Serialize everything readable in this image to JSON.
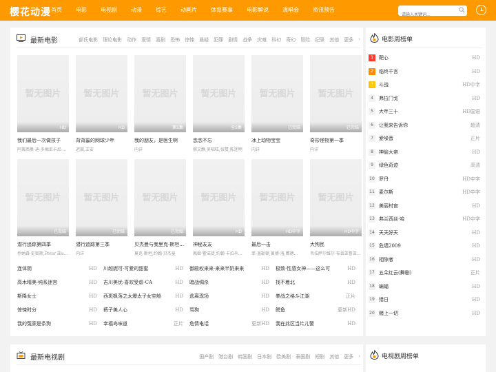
{
  "header": {
    "logo": "樱花动漫",
    "nav": [
      "首页",
      "电影",
      "电视剧",
      "动漫",
      "综艺",
      "动画片",
      "体育赛事",
      "电影解说",
      "演唱会",
      "资讯预告"
    ],
    "search_placeholder": "请输入关键词..."
  },
  "colors": {
    "brand": "#ff9900",
    "rank1": "#ff3b30",
    "rank2": "#ff8a00",
    "rank3": "#ffc400"
  },
  "movies_section": {
    "title": "最新电影",
    "categories": [
      "部氏电影",
      "理论电影",
      "动作",
      "爱情",
      "喜剧",
      "恐怖",
      "惊悚",
      "悬疑",
      "犯罪",
      "剧情",
      "战争",
      "灾难",
      "科幻",
      "奇幻",
      "冒险",
      "纪录",
      "其他",
      "更多"
    ],
    "placeholder_text": "暂无图片",
    "cards": [
      {
        "title": "我们最后一次做孩子",
        "sub": "阿莱西奥·迪·多梅尼卡尼·…",
        "badge": "HD"
      },
      {
        "title": "背背篓的网球少年",
        "sub": "迟嵩,王安",
        "badge": "HD"
      },
      {
        "title": "我的朋友，是医生啊",
        "sub": "内详",
        "badge": "第5集"
      },
      {
        "title": "念念不忘",
        "sub": "郝文静,吴昭旺,张赞,陈连明",
        "badge": "全5集"
      },
      {
        "title": "冰上动物宝宝",
        "sub": "内详",
        "badge": "已完结"
      },
      {
        "title": "奇形怪物第一季",
        "sub": "内详",
        "badge": "已完结"
      },
      {
        "title": "潜行追踪第四季",
        "sub": "乔纳森·史密斯,Peter Ble…",
        "badge": "已完结"
      },
      {
        "title": "潜行追踪第三季",
        "sub": "内详",
        "badge": "已完结"
      },
      {
        "title": "贝杰曼与我里克·斯坦…",
        "sub": "莫克·斯坦,约翰·贝杰曼",
        "badge": "已完结"
      },
      {
        "title": "神秘友友",
        "sub": "佩姬·霍诺徒,约翰·卡拉辛…",
        "badge": "HD"
      },
      {
        "title": "最后一击",
        "sub": "菲·温勒顿,黄德·洛,鹰德…",
        "badge": "HD中字"
      },
      {
        "title": "大狗民",
        "sub": "韦拉萨尔维尔·布丢亚鲁亚斯·奥…",
        "badge": "HD中字"
      }
    ],
    "text_list": [
      [
        {
          "n": "连体阴",
          "s": "HD"
        },
        {
          "n": "川越妮可·可爱的甜蜜",
          "s": "HD"
        },
        {
          "n": "御殿权来来·来来半奶来来",
          "s": "HD"
        },
        {
          "n": "极致·性感女神——这么可",
          "s": "HD"
        }
      ],
      [
        {
          "n": "高木晴美·纯系迷宫",
          "s": "HD"
        },
        {
          "n": "吉川美优·喜欢受虐-CA",
          "s": "HD"
        },
        {
          "n": "暗战绸杀",
          "s": "HD"
        },
        {
          "n": "找不着北",
          "s": "HD"
        }
      ],
      [
        {
          "n": "斯降女士",
          "s": "HD"
        },
        {
          "n": "西斑枫落之太爆太子女空舱",
          "s": "HD"
        },
        {
          "n": "逃离现场",
          "s": "HD"
        },
        {
          "n": "拳战之格斗江湖",
          "s": "正片"
        }
      ],
      [
        {
          "n": "惊悚时分",
          "s": "HD"
        },
        {
          "n": "裤子美人心",
          "s": "HD"
        },
        {
          "n": "骂狗",
          "s": "HD"
        },
        {
          "n": "鳄鱼",
          "s": "更新HD"
        }
      ],
      [
        {
          "n": "我的冤家是条狗",
          "s": "HD"
        },
        {
          "n": "幸福岛味道",
          "s": "正片"
        },
        {
          "n": "危情电话",
          "s": "更新HD"
        },
        {
          "n": "我在此区当片儿警",
          "s": "HD"
        }
      ]
    ]
  },
  "movie_rank": {
    "title": "电影周榜单",
    "items": [
      {
        "rank": "1",
        "name": "靶心",
        "status": "HD"
      },
      {
        "rank": "2",
        "name": "临终千言",
        "status": "HD"
      },
      {
        "rank": "3",
        "name": "斗战",
        "status": "HD中字"
      },
      {
        "rank": "4",
        "name": "弗拉门戈",
        "status": "HD"
      },
      {
        "rank": "5",
        "name": "大年三十",
        "status": "HD国语"
      },
      {
        "rank": "6",
        "name": "让我来告诉你",
        "status": "超清"
      },
      {
        "rank": "7",
        "name": "爱噪音",
        "status": "正片"
      },
      {
        "rank": "8",
        "name": "神偷大帝",
        "status": "HD"
      },
      {
        "rank": "9",
        "name": "绿色奇迹",
        "status": "高清"
      },
      {
        "rank": "10",
        "name": "罗丹",
        "status": "HD中字"
      },
      {
        "rank": "11",
        "name": "麦尔斯",
        "status": "HD中字"
      },
      {
        "rank": "12",
        "name": "美丽村官",
        "status": "HD"
      },
      {
        "rank": "13",
        "name": "弗兰西丝·哈",
        "status": "HD中字"
      },
      {
        "rank": "14",
        "name": "天天好天",
        "status": "HD"
      },
      {
        "rank": "15",
        "name": "危墙2009",
        "status": "HD"
      },
      {
        "rank": "16",
        "name": "相隙者",
        "status": "HD"
      },
      {
        "rank": "17",
        "name": "五朵红云(舞剧)",
        "status": "正片"
      },
      {
        "rank": "18",
        "name": "蝙蝠",
        "status": "HD"
      },
      {
        "rank": "19",
        "name": "猎日",
        "status": "HD"
      },
      {
        "rank": "20",
        "name": "赌上一切",
        "status": "HD"
      }
    ]
  },
  "tv_section": {
    "title": "最新电视剧",
    "categories": [
      "国产剧",
      "港台剧",
      "韩国剧",
      "日本剧",
      "欧美剧",
      "泰国剧",
      "短剧",
      "其他",
      "更多"
    ]
  },
  "tv_rank": {
    "title": "电视剧周榜单"
  }
}
